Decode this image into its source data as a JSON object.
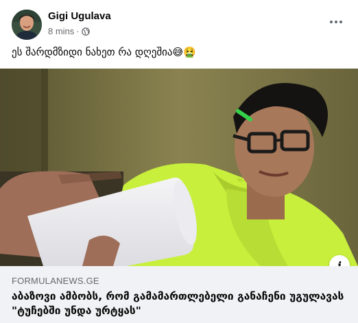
{
  "post": {
    "author": "Gigi Ugulava",
    "time": "8 mins",
    "separator": "·",
    "text": "ეს შარდმზიდი ნახეთ რა დღეშია😅🤮"
  },
  "link": {
    "source": "FORMULANEWS.GE",
    "title": "აბაზოვი ამბობს, რომ გამამართლებელი განაჩენი უგულავას \"ტუჩებში უნდა ურტყას\""
  },
  "icons": {
    "privacy": "globe-icon",
    "more": "more-options-icon",
    "info": "info-icon"
  },
  "colors": {
    "meta_text": "#65676b",
    "link_background": "#f0f2f5",
    "shirt_green": "#c7f03c"
  }
}
